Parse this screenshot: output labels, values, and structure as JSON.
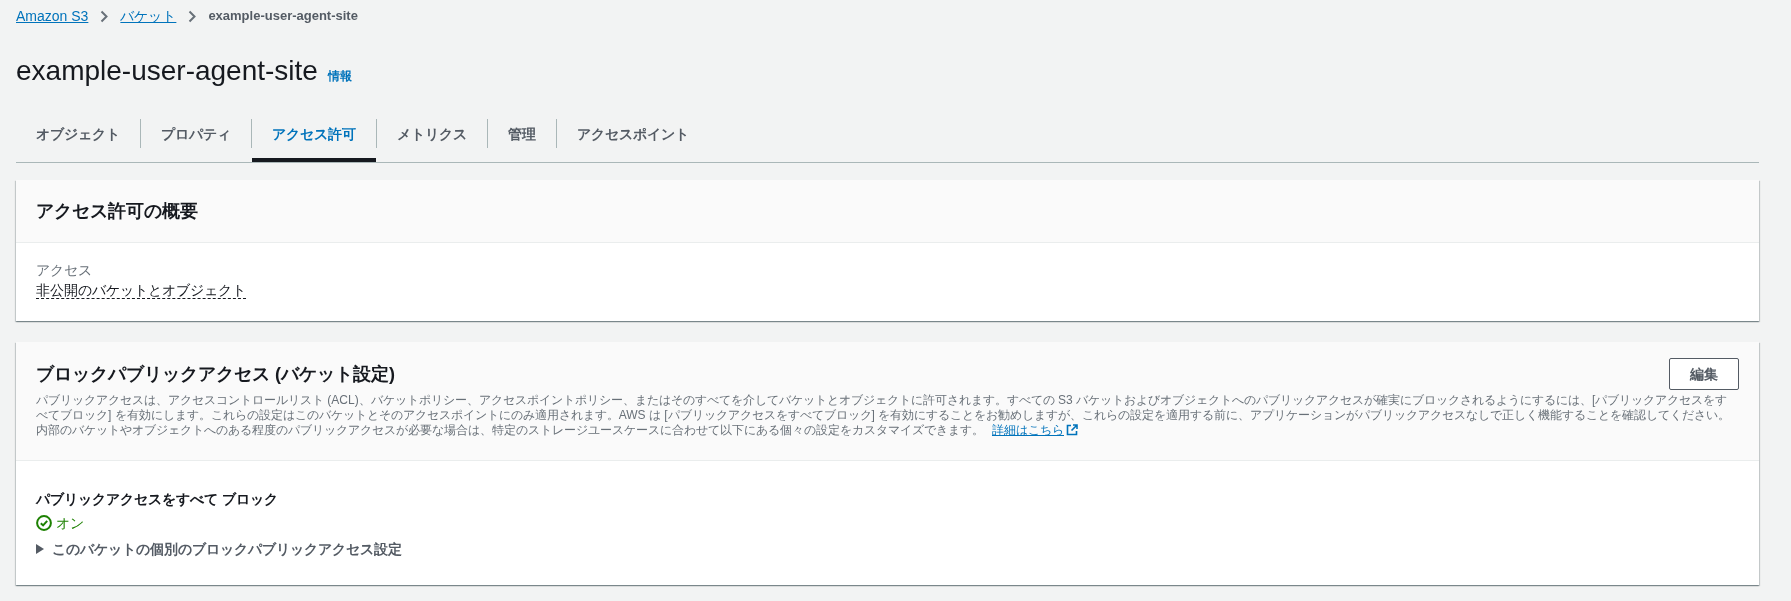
{
  "breadcrumb": [
    {
      "label": "Amazon S3",
      "kind": "link"
    },
    {
      "label": "バケット",
      "kind": "link"
    },
    {
      "label": "example-user-agent-site",
      "kind": "current"
    }
  ],
  "page": {
    "title": "example-user-agent-site",
    "info_link": "情報"
  },
  "tabs": [
    {
      "label": "オブジェクト",
      "selected": false
    },
    {
      "label": "プロパティ",
      "selected": false
    },
    {
      "label": "アクセス許可",
      "selected": true
    },
    {
      "label": "メトリクス",
      "selected": false
    },
    {
      "label": "管理",
      "selected": false
    },
    {
      "label": "アクセスポイント",
      "selected": false
    }
  ],
  "summary_panel": {
    "title": "アクセス許可の概要",
    "fields": [
      {
        "label": "アクセス",
        "value": "非公開のバケットとオブジェクト"
      }
    ]
  },
  "block_public_access_panel": {
    "title": "ブロックパブリックアクセス (バケット設定)",
    "edit_button": "編集",
    "description": "パブリックアクセスは、アクセスコントロールリスト (ACL)、バケットポリシー、アクセスポイントポリシー、またはそのすべてを介してバケットとオブジェクトに許可されます。すべての S3 バケットおよびオブジェクトへのパブリックアクセスが確実にブロックされるようにするには、[パブリックアクセスをすべてブロック] を有効にします。これらの設定はこのバケットとそのアクセスポイントにのみ適用されます。AWS は [パブリックアクセスをすべてブロック] を有効にすることをお勧めしますが、これらの設定を適用する前に、アプリケーションがパブリックアクセスなしで正しく機能することを確認してください。内部のバケットやオブジェクトへのある程度のパブリックアクセスが必要な場合は、特定のストレージユースケースに合わせて以下にある個々の設定をカスタマイズできます。",
    "learn_more_link": "詳細はこちら",
    "settings": [
      {
        "label": "パブリックアクセスをすべて ブロック",
        "status": "オン",
        "on": true
      }
    ],
    "expander": {
      "label": "このバケットの個別のブロックパブリックアクセス設定",
      "expanded": false
    }
  }
}
